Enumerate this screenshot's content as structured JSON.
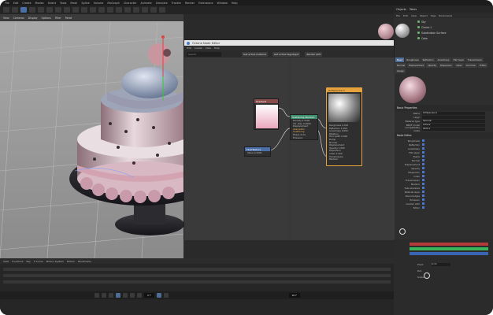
{
  "menubar": {
    "items": [
      "File",
      "Edit",
      "Create",
      "Modes",
      "Select",
      "Tools",
      "Mesh",
      "Spline",
      "Volume",
      "MoGraph",
      "Character",
      "Animate",
      "Simulate",
      "Tracker",
      "Render",
      "Extensions",
      "Window",
      "Help"
    ]
  },
  "viewport": {
    "menu": [
      "View",
      "Cameras",
      "Display",
      "Options",
      "Filter",
      "Panel"
    ]
  },
  "objects_panel": {
    "tabs": [
      "Objects",
      "Takes"
    ],
    "menu": [
      "File",
      "Edit",
      "View",
      "Object",
      "Tags",
      "Bookmarks"
    ],
    "items": [
      "Sky",
      "Cloner.1",
      "Subdivision Surface",
      "Cake"
    ]
  },
  "node_editor": {
    "title": "Octane Node Editor",
    "menu": [
      "Edit",
      "Create",
      "View",
      "Help"
    ],
    "search_placeholder": "Search",
    "buttons": [
      "Get active material",
      "Get active tag/object",
      "Render AOV"
    ],
    "nodes": {
      "gradient": {
        "title": "Gradient"
      },
      "floattexture": {
        "title": "FloatTexture",
        "rows": [
          "Value  0.2000"
        ]
      },
      "scattering": {
        "title": "Scattering Medium",
        "rows": [
          "Density  0.5500",
          "Vol. step  4.0000",
          "Displacement",
          "Absorption",
          "Scattering",
          "Phase (0.0)",
          "Emission"
        ]
      },
      "material": {
        "title": "OctSpecular.1",
        "rows": [
          "Roughness  0.010",
          "Reflection  1.000",
          "Anisotropy  0.000",
          "Rotation",
          "Film width  0.000",
          "Bump",
          "Normal",
          "Displacement",
          "Opacity  1.000",
          "Dispersion",
          "Index  1.500",
          "Transmission",
          "Medium"
        ]
      }
    }
  },
  "properties": {
    "tabs": [
      "Basic",
      "Roughness",
      "Reflection",
      "Anisotropy",
      "Film layer",
      "Transmission",
      "Normal",
      "Displacement",
      "Opacity",
      "Dispersion",
      "Index",
      "Common",
      "Editor",
      "Assign"
    ],
    "section_basic": "Basic Properties",
    "name_label": "Name",
    "name_value": "OctSpecular.1",
    "layer_label": "Layer",
    "rows": [
      {
        "label": "Material type",
        "value": "Specular"
      },
      {
        "label": "BRDF model",
        "value": "Octane"
      },
      {
        "label": "Compatibility mode",
        "value": "2020.1"
      }
    ],
    "section_node": "Node Editor",
    "channels": [
      "Roughness",
      "Reflection",
      "Anisotropy",
      "Film layer",
      "Bump",
      "Normal",
      "Displacement",
      "Opacity",
      "Dispersion",
      "Index",
      "Transmission",
      "Medium",
      "Fake shadows",
      "Material layer",
      "Round edges",
      "Emission",
      "Custom AOV",
      "Editor"
    ]
  },
  "timeline": {
    "menu": [
      "View",
      "Functions",
      "Key",
      "F-Curve",
      "Motion System",
      "Motion",
      "Bookmarks"
    ],
    "frame": "0 F",
    "end": "90 F"
  },
  "coords": {
    "labels": [
      "Pivot",
      "Rot.",
      "Scale"
    ],
    "field": "0 cm"
  },
  "colors": {
    "accent": "#4d6c96",
    "material_border": "#e6a23c",
    "select_green": "#6ac06a"
  }
}
